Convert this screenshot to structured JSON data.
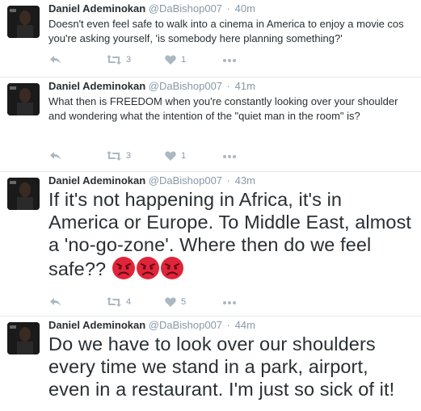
{
  "colors": {
    "name": "#292f33",
    "meta": "#8899a6",
    "icon": "#aab8c2",
    "divider": "#e1e8ed",
    "emoji": "#e0243a"
  },
  "icons": [
    "reply-icon",
    "retweet-icon",
    "like-icon",
    "more-icon",
    "angry-face-icon"
  ],
  "tweets": [
    {
      "name": "Daniel Ademinokan",
      "handle": "@DaBishop007",
      "sep": "·",
      "time": "40m",
      "text": "Doesn't even feel safe to walk into a cinema in America to enjoy a movie cos you're asking yourself, 'is somebody here planning something?'",
      "retweets": "3",
      "likes": "1"
    },
    {
      "name": "Daniel Ademinokan",
      "handle": "@DaBishop007",
      "sep": "·",
      "time": "41m",
      "text": "What then is FREEDOM when you're constantly looking over your shoulder and wondering what the intention of the \"quiet man in the room\" is?",
      "retweets": "3",
      "likes": "1"
    },
    {
      "name": "Daniel Ademinokan",
      "handle": "@DaBishop007",
      "sep": "·",
      "time": "43m",
      "text": "If it's not happening in Africa, it's in America or Europe. To Middle East, almost a 'no-go-zone'. Where then do we feel safe?? ",
      "retweets": "4",
      "likes": "5"
    },
    {
      "name": "Daniel Ademinokan",
      "handle": "@DaBishop007",
      "sep": "·",
      "time": "44m",
      "text": "Do we have to look over our shoulders every time we stand in a park, airport, even in a restaurant. I'm just so sick of it!"
    }
  ]
}
